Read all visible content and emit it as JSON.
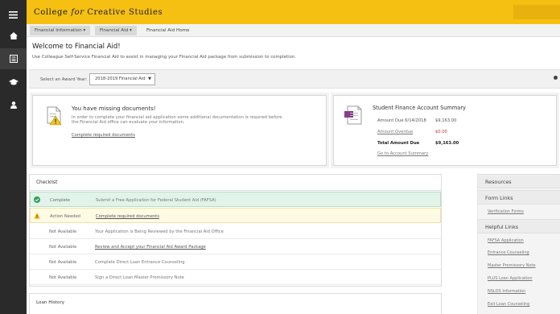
{
  "app": {
    "logo_part1": "College ",
    "logo_italic": "for",
    "logo_part2": " Creative Studies"
  },
  "nav": {
    "icons": [
      "hamburger-menu-icon",
      "home-icon",
      "bank-icon",
      "graduation-cap-icon",
      "user-icon"
    ]
  },
  "breadcrumb": {
    "items": [
      "Financial Information",
      "Financial Aid",
      "Financial Aid Home"
    ]
  },
  "page": {
    "title": "Welcome to Financial Aid!",
    "intro": "Use Colleague Self-Service Financial Aid to assist in managing your Financial Aid package from submission to completion."
  },
  "award_year": {
    "label": "Select an Award Year:",
    "selected": "2018-2019 Financial Aid"
  },
  "missing_docs": {
    "title": "You have missing documents!",
    "text": "In order to complete your financial aid application some additional documentation is required before the Financial Aid office can evaluate your information.",
    "link": "Complete required documents"
  },
  "finance_summary": {
    "title": "Student Finance Account Summary",
    "rows": [
      {
        "label": "Amount Due 6/14/2018",
        "value": "$9,163.00"
      },
      {
        "label": "Amount Overdue",
        "value": "$0.00"
      },
      {
        "label": "Total Amount Due",
        "value": "$9,163.00"
      }
    ],
    "link": "Go to Account Summary"
  },
  "checklist": {
    "title": "Checklist",
    "rows": [
      {
        "status": "Complete",
        "task": "Submit a Free Application for Federal Student Aid (FAFSA)",
        "is_link": false
      },
      {
        "status": "Action Needed",
        "task": "Complete required documents",
        "is_link": true
      },
      {
        "status": "Not Available",
        "task": "Your Application is Being Reviewed by the Financial Aid Office",
        "is_link": false
      },
      {
        "status": "Not Available",
        "task": "Review and Accept your Financial Aid Award Package",
        "is_link": true
      },
      {
        "status": "Not Available",
        "task": "Complete Direct Loan Entrance Counseling",
        "is_link": false
      },
      {
        "status": "Not Available",
        "task": "Sign a Direct Loan Master Promissory Note",
        "is_link": false
      }
    ]
  },
  "loan_history": {
    "title": "Loan History"
  },
  "resources": {
    "title": "Resources",
    "form_links_title": "Form Links",
    "form_links": [
      "Verification Forms"
    ],
    "helpful_links_title": "Helpful Links",
    "helpful_links": [
      "FAFSA Application",
      "Entrance Counseling",
      "Master Promissory Note",
      "PLUS Loan Application",
      "NSLDS Information",
      "Exit Loan Counseling"
    ]
  }
}
